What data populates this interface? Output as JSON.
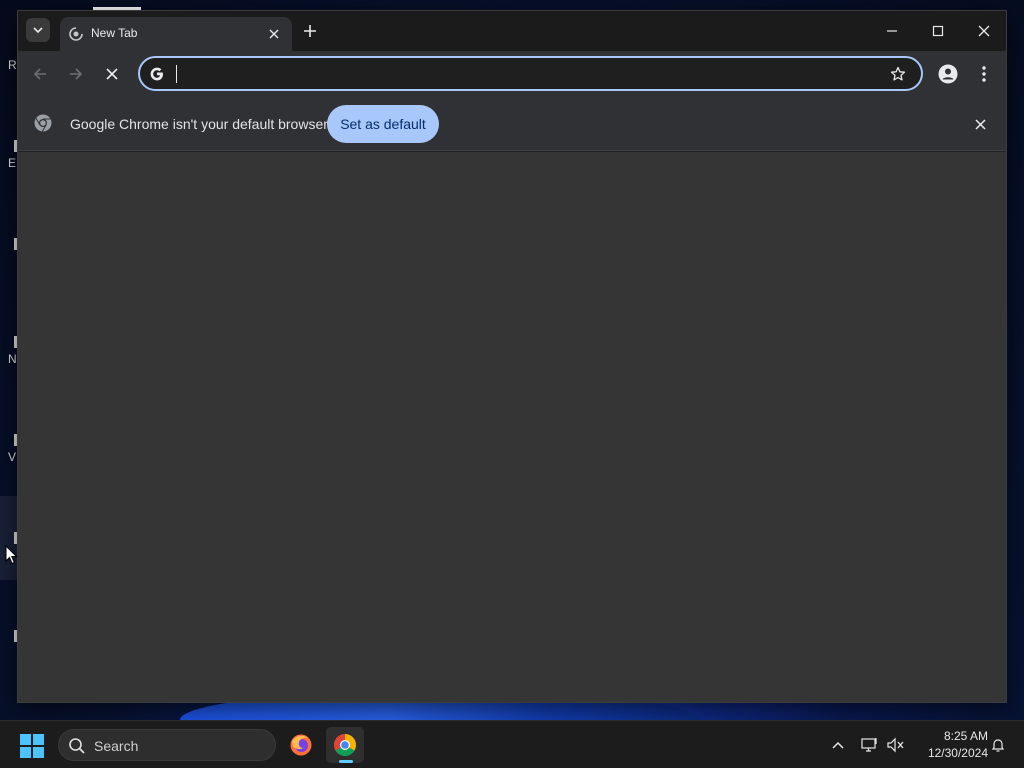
{
  "desktop": {
    "icon_letters": [
      "R",
      "E",
      "N",
      "V"
    ]
  },
  "browser": {
    "tab": {
      "title": "New Tab"
    },
    "omnibox": {
      "value": "",
      "placeholder": ""
    },
    "infobar": {
      "message": "Google Chrome isn't your default browser",
      "button_label": "Set as default"
    }
  },
  "taskbar": {
    "search_label": "Search",
    "apps": [
      {
        "name": "Firefox",
        "icon": "firefox-icon"
      },
      {
        "name": "Google Chrome",
        "icon": "chrome-icon",
        "active": true
      }
    ],
    "clock": {
      "time": "8:25 AM",
      "date": "12/30/2024"
    }
  },
  "colors": {
    "accent": "#a8c7fa",
    "accent_text": "#062e6f",
    "content_bg": "#353535",
    "toolbar_bg": "#303134",
    "taskbar_bg": "#1c1c1c"
  }
}
